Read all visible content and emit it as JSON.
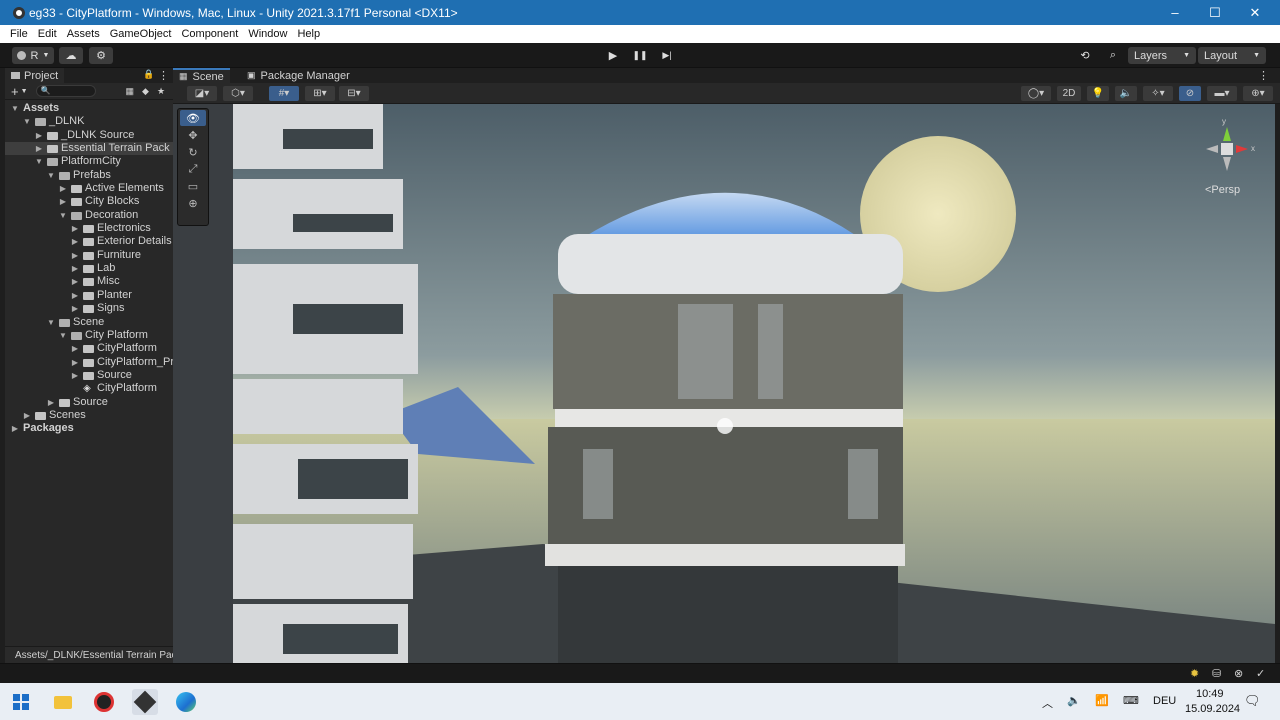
{
  "window": {
    "title": "eg33 - CityPlatform - Windows, Mac, Linux - Unity 2021.3.17f1 Personal <DX11>",
    "minimize": "–",
    "maximize": "☐",
    "close": "✕"
  },
  "menu": [
    "File",
    "Edit",
    "Assets",
    "GameObject",
    "Component",
    "Window",
    "Help"
  ],
  "toolbar": {
    "account": "R",
    "layers_label": "Layers",
    "layout_label": "Layout",
    "play": "▶",
    "pause": "❚❚",
    "step": "▶|"
  },
  "project": {
    "tab": "Project",
    "add": "+",
    "search_placeholder": "🔍",
    "path": "Assets/_DLNK/Essential Terrain Pack"
  },
  "tree": [
    {
      "label": "Assets",
      "depth": 0,
      "expanded": true,
      "bold": true,
      "folder": false
    },
    {
      "label": "_DLNK",
      "depth": 1,
      "expanded": true,
      "folder": true
    },
    {
      "label": "_DLNK Source",
      "depth": 2,
      "expanded": false,
      "folder": true
    },
    {
      "label": "Essential Terrain Pack",
      "depth": 2,
      "expanded": false,
      "folder": true,
      "selected": true
    },
    {
      "label": "PlatformCity",
      "depth": 2,
      "expanded": true,
      "folder": true
    },
    {
      "label": "Prefabs",
      "depth": 3,
      "expanded": true,
      "folder": true
    },
    {
      "label": "Active Elements",
      "depth": 4,
      "expanded": false,
      "folder": true
    },
    {
      "label": "City Blocks",
      "depth": 4,
      "expanded": false,
      "folder": true
    },
    {
      "label": "Decoration",
      "depth": 4,
      "expanded": true,
      "folder": true
    },
    {
      "label": "Electronics",
      "depth": 5,
      "expanded": false,
      "folder": true
    },
    {
      "label": "Exterior Details",
      "depth": 5,
      "expanded": false,
      "folder": true
    },
    {
      "label": "Furniture",
      "depth": 5,
      "expanded": false,
      "folder": true
    },
    {
      "label": "Lab",
      "depth": 5,
      "expanded": false,
      "folder": true
    },
    {
      "label": "Misc",
      "depth": 5,
      "expanded": false,
      "folder": true
    },
    {
      "label": "Planter",
      "depth": 5,
      "expanded": false,
      "folder": true
    },
    {
      "label": "Signs",
      "depth": 5,
      "expanded": false,
      "folder": true
    },
    {
      "label": "Scene",
      "depth": 3,
      "expanded": true,
      "folder": true
    },
    {
      "label": "City Platform",
      "depth": 4,
      "expanded": true,
      "folder": true
    },
    {
      "label": "CityPlatform",
      "depth": 5,
      "expanded": false,
      "folder": true
    },
    {
      "label": "CityPlatform_Pro",
      "depth": 5,
      "expanded": false,
      "folder": true
    },
    {
      "label": "Source",
      "depth": 5,
      "expanded": false,
      "folder": true
    },
    {
      "label": "CityPlatform",
      "depth": 5,
      "expanded": null,
      "folder": false,
      "unity": true
    },
    {
      "label": "Source",
      "depth": 3,
      "expanded": false,
      "folder": true
    },
    {
      "label": "Scenes",
      "depth": 2,
      "expanded": false,
      "folder": true,
      "indentOverride": 1
    },
    {
      "label": "Packages",
      "depth": 0,
      "expanded": false,
      "bold": true,
      "folder": false
    }
  ],
  "scene": {
    "tabs": [
      "Scene",
      "Package Manager"
    ],
    "mode_2d": "2D",
    "persp": "<Persp",
    "gizmo_y": "y",
    "gizmo_x": "x"
  },
  "taskbar": {
    "lang": "DEU",
    "time": "10:49",
    "date": "15.09.2024"
  },
  "colors": {
    "title_bg": "#1f6fb2",
    "accent": "#3a5e8c"
  }
}
